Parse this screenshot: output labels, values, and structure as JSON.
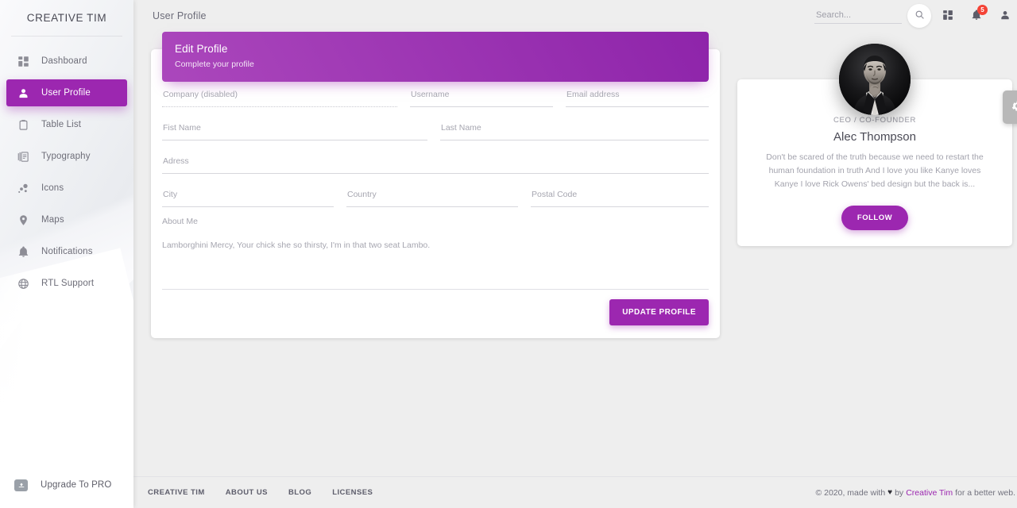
{
  "sidebar": {
    "brand": "CREATIVE TIM",
    "items": [
      {
        "label": "Dashboard",
        "icon": "dashboard-icon",
        "active": false
      },
      {
        "label": "User Profile",
        "icon": "person-icon",
        "active": true
      },
      {
        "label": "Table List",
        "icon": "clipboard-icon",
        "active": false
      },
      {
        "label": "Typography",
        "icon": "library-books-icon",
        "active": false
      },
      {
        "label": "Icons",
        "icon": "bubble-chart-icon",
        "active": false
      },
      {
        "label": "Maps",
        "icon": "location-pin-icon",
        "active": false
      },
      {
        "label": "Notifications",
        "icon": "bell-icon",
        "active": false
      },
      {
        "label": "RTL Support",
        "icon": "globe-icon",
        "active": false
      }
    ],
    "upgrade": {
      "label": "Upgrade To PRO",
      "icon": "unarchive-icon"
    }
  },
  "topbar": {
    "title": "User Profile",
    "search": {
      "value": "",
      "placeholder": "Search..."
    },
    "search_button_icon": "search-icon",
    "dashboard_icon": "dashboard-grid-icon",
    "notifications": {
      "icon": "bell-icon",
      "badge": "5"
    },
    "account_icon": "person-icon"
  },
  "settings_fab": {
    "icon": "gear-icon"
  },
  "edit_card": {
    "title": "Edit Profile",
    "subtitle": "Complete your profile",
    "fields": [
      {
        "label": "Company (disabled)",
        "value": "",
        "disabled": true
      },
      {
        "label": "Username",
        "value": "",
        "disabled": false
      },
      {
        "label": "Email address",
        "value": "",
        "disabled": false
      },
      {
        "label": "Fist Name",
        "value": "",
        "disabled": false
      },
      {
        "label": "Last Name",
        "value": "",
        "disabled": false
      },
      {
        "label": "Adress",
        "value": "",
        "disabled": false
      },
      {
        "label": "City",
        "value": "",
        "disabled": false
      },
      {
        "label": "Country",
        "value": "",
        "disabled": false
      },
      {
        "label": "Postal Code",
        "value": "",
        "disabled": false
      }
    ],
    "about_label": "About Me",
    "about_value": "Lamborghini Mercy, Your chick she so thirsty, I'm in that two seat Lambo.",
    "submit_label": "UPDATE PROFILE"
  },
  "profile_card": {
    "avatar_alt": "avatar",
    "role": "CEO / CO-FOUNDER",
    "name": "Alec Thompson",
    "description": "Don't be scared of the truth because we need to restart the human foundation in truth And I love you like Kanye loves Kanye I love Rick Owens' bed design but the back is...",
    "follow_label": "FOLLOW"
  },
  "footer": {
    "links": [
      "CREATIVE TIM",
      "ABOUT US",
      "BLOG",
      "LICENSES"
    ],
    "copy_prefix": "© 2020, made with",
    "heart": "♥",
    "copy_by": "by",
    "brand": "Creative Tim",
    "copy_suffix": "for a better web."
  },
  "colors": {
    "accent": "#9c27b0",
    "accent_light": "#ab47bc",
    "badge": "#f44336"
  }
}
